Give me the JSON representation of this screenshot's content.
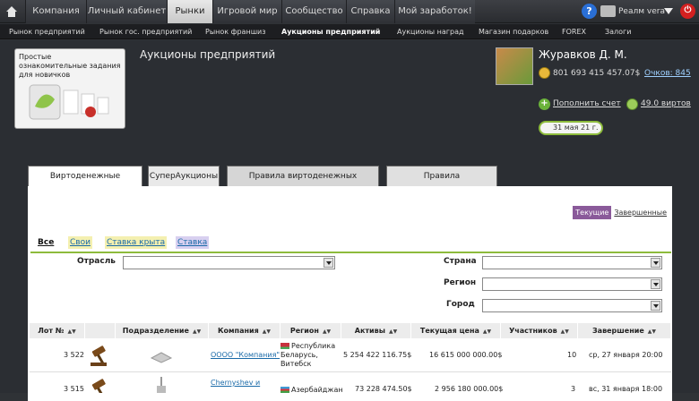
{
  "nav": {
    "items": [
      "Компания",
      "Личный кабинет",
      "Рынки",
      "Игровой мир",
      "Сообщество",
      "Справка",
      "Мой заработок!"
    ],
    "active": "Рынки",
    "realm": "Реалм vera"
  },
  "subnav": {
    "items": [
      "Рынок предприятий",
      "Рынок гос. предприятий",
      "Рынок франшиз",
      "Аукционы предприятий",
      "Аукционы наград",
      "Магазин подарков",
      "FOREX",
      "Залоги"
    ],
    "active": "Аукционы предприятий"
  },
  "promo": {
    "text": "Простые ознакомительные задания для новичков"
  },
  "page_title": "Аукционы предприятий",
  "profile": {
    "name": "Журавков Д. М.",
    "money": "801 693 415 457.07$",
    "points": "Очков: 845",
    "topup": "Пополнить счет",
    "virts": "49.0 виртов",
    "date": "31 мая 21 г."
  },
  "tabs": [
    "Виртоденежные аукционы",
    "СуперАукционы",
    "Правила виртоденежных аукционов",
    "Правила СуперАукционов"
  ],
  "status_filter": {
    "current": "Текущие",
    "finished": "Завершенные"
  },
  "filter_tabs": [
    "Все",
    "Свои",
    "Ставка крыта",
    "Ставка"
  ],
  "filters": {
    "industry": "Отрасль",
    "country": "Страна",
    "region": "Регион",
    "city": "Город"
  },
  "table": {
    "headers": [
      "Лот №",
      "",
      "Подразделение",
      "Компания",
      "Регион",
      "Активы",
      "Текущая цена",
      "Участников",
      "Завершение"
    ],
    "rows": [
      {
        "lot": "3 522",
        "company": "ОООО \"Компания\"",
        "region_line1": "Республика",
        "region_line2": "Беларусь,",
        "region_line3": "Витебск",
        "assets": "5 254 422 116.75$",
        "price": "16 615 000 000.00$",
        "participants": "10",
        "end": "ср, 27 января 20:00"
      },
      {
        "lot": "3 515",
        "company": "Chernyshev и",
        "region_line1": "Азербайджан",
        "region_line2": "",
        "region_line3": "",
        "assets": "73 228 474.50$",
        "price": "2 956 180 000.00$",
        "participants": "3",
        "end": "вс, 31 января 18:00"
      }
    ]
  },
  "colors": {
    "nav_active": "#d4d4d4",
    "accent_green": "#8dbb3c",
    "current_purple": "#8a5a9a"
  }
}
